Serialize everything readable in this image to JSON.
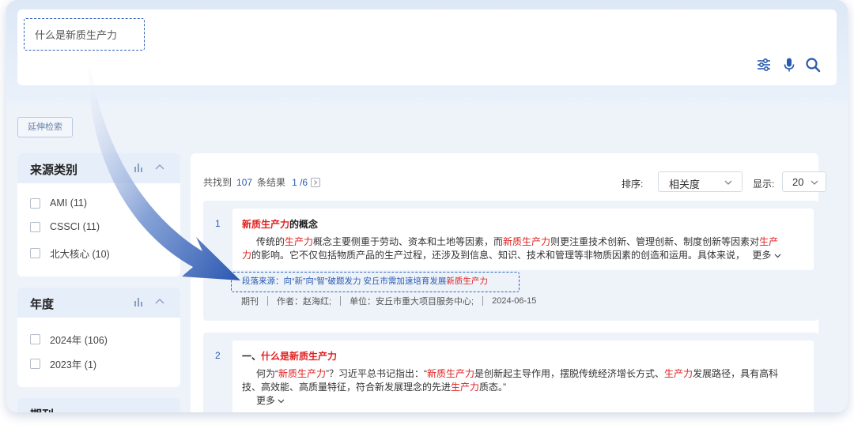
{
  "search": {
    "query": "什么是新质生产力"
  },
  "toolbar": {
    "icons": [
      "filter-sliders-icon",
      "microphone-icon",
      "search-icon"
    ],
    "accent": "#2a5bb0"
  },
  "extended_search_label": "延伸检索",
  "facets": {
    "source": {
      "title": "来源类别",
      "options": [
        {
          "label": "AMI (11)"
        },
        {
          "label": "CSSCI (11)"
        },
        {
          "label": "北大核心 (10)"
        }
      ]
    },
    "year": {
      "title": "年度",
      "options": [
        {
          "label": "2024年 (106)"
        },
        {
          "label": "2023年 (1)"
        }
      ]
    },
    "journal": {
      "title": "期刊"
    }
  },
  "summary": {
    "prefix": "共找到",
    "count": "107",
    "suffix": "条结果",
    "page": "1 /6"
  },
  "sort": {
    "label": "排序:",
    "value": "相关度"
  },
  "display": {
    "label": "显示:",
    "value": "20"
  },
  "results": [
    {
      "index": "1",
      "title_hl": "新质生产力",
      "title_rest": "的概念",
      "body": [
        {
          "t": "传统的",
          "hl": false
        },
        {
          "t": "生产力",
          "hl": true
        },
        {
          "t": "概念主要侧重于劳动、资本和土地等因素，而",
          "hl": false
        },
        {
          "t": "新质生产力",
          "hl": true
        },
        {
          "t": "则更注重技术创新、管理创新、制度创新等因素对",
          "hl": false
        },
        {
          "t": "生产力",
          "hl": true
        },
        {
          "t": "的影响。它不仅包括物质产品的生产过程，还涉及到信息、知识、技术和管理等非物质因素的创造和运用。具体来说，",
          "hl": false
        }
      ],
      "more": "更多",
      "source_prefix": "段落来源：向“新”向“智”破题发力 安丘市需加速培育发展",
      "source_hl": "新质生产力",
      "meta": [
        "期刊",
        "作者：赵海红;",
        "单位：安丘市重大项目服务中心;",
        "2024-06-15"
      ]
    },
    {
      "index": "2",
      "title_prefix": "一、",
      "title_hl": "什么是新质生产力",
      "body": [
        {
          "t": "何为“",
          "hl": false
        },
        {
          "t": "新质生产力",
          "hl": true
        },
        {
          "t": "”？习近平总书记指出：“",
          "hl": false
        },
        {
          "t": "新质生产力",
          "hl": true
        },
        {
          "t": "是创新起主导作用，摆脱传统经济增长方式、",
          "hl": false
        },
        {
          "t": "生产力",
          "hl": true
        },
        {
          "t": "发展路径，具有高科技、高效能、高质量特征，符合新发展理念的先进",
          "hl": false
        },
        {
          "t": "生产力",
          "hl": true
        },
        {
          "t": "质态。”",
          "hl": false
        }
      ],
      "more": "更多"
    }
  ]
}
